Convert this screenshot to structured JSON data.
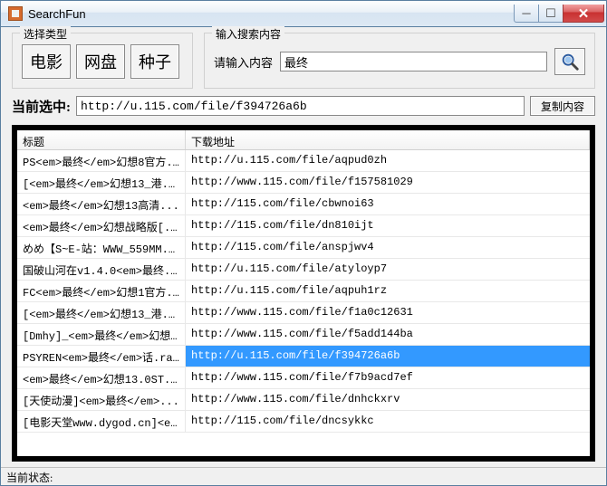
{
  "window": {
    "title": "SearchFun"
  },
  "typeGroup": {
    "legend": "选择类型",
    "buttons": [
      "电影",
      "网盘",
      "种子"
    ]
  },
  "searchGroup": {
    "legend": "输入搜索内容",
    "label": "请输入内容",
    "value": "最终"
  },
  "selection": {
    "label": "当前选中:",
    "value": "http://u.115.com/file/f394726a6b",
    "copyLabel": "复制内容"
  },
  "columns": {
    "title": "标题",
    "url": "下载地址"
  },
  "rows": [
    {
      "title": "PS<em>最终</em>幻想8官方...",
      "url": "http://u.115.com/file/aqpud0zh"
    },
    {
      "title": "[<em>最终</em>幻想13_港...",
      "url": "http://www.115.com/file/f157581029"
    },
    {
      "title": "<em>最终</em>幻想13高清...",
      "url": "http://115.com/file/cbwnoi63"
    },
    {
      "title": "<em>最终</em>幻想战略版[...",
      "url": "http://115.com/file/dn810ijt"
    },
    {
      "title": "めめ【S~E-站：WWW_559MM...",
      "url": "http://115.com/file/anspjwv4"
    },
    {
      "title": "国破山河在v1.4.0<em>最终...",
      "url": "http://u.115.com/file/atyloyp7"
    },
    {
      "title": "FC<em>最终</em>幻想1官方...",
      "url": "http://u.115.com/file/aqpuh1rz"
    },
    {
      "title": "[<em>最终</em>幻想13_港...",
      "url": "http://www.115.com/file/f1a0c12631"
    },
    {
      "title": "[Dmhy]_<em>最终</em>幻想...",
      "url": "http://www.115.com/file/f5add144ba"
    },
    {
      "title": "PSYREN<em>最终</em>话.ra...",
      "url": "http://u.115.com/file/f394726a6b",
      "selected": true
    },
    {
      "title": "<em>最终</em>幻想13.0ST...",
      "url": "http://www.115.com/file/f7b9acd7ef"
    },
    {
      "title": "[天使动漫]<em>最终</em>...",
      "url": "http://www.115.com/file/dnhckxrv"
    },
    {
      "title": "[电影天堂www.dygod.cn]<e...",
      "url": "http://115.com/file/dncsykkc"
    }
  ],
  "status": "当前状态:"
}
